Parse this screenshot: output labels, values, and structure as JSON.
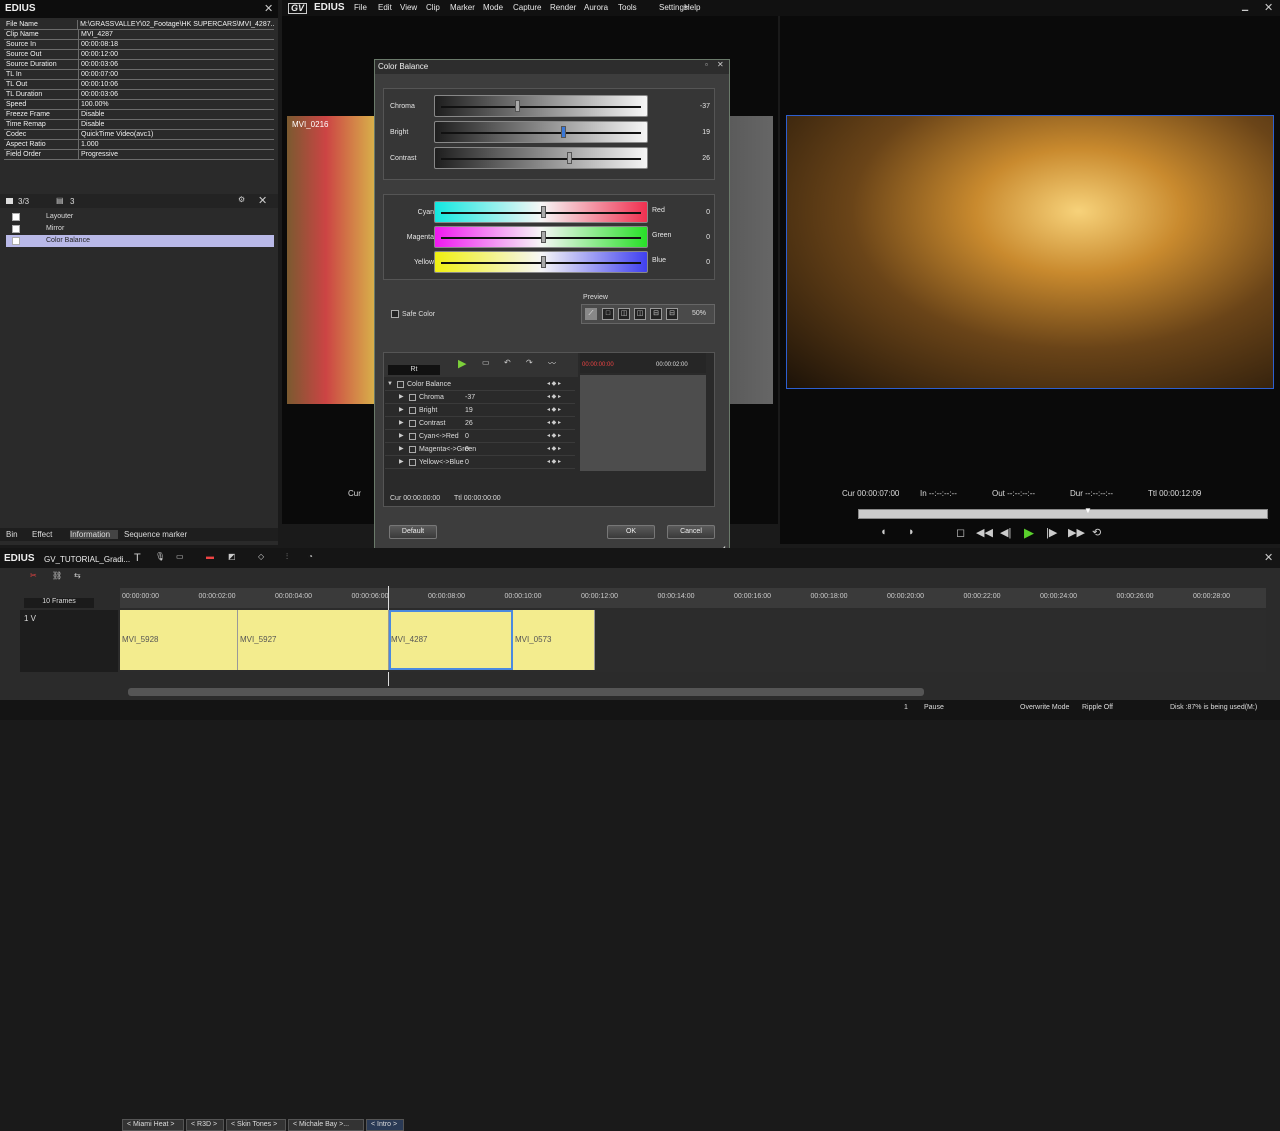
{
  "app": {
    "name": "EDIUS",
    "menus": [
      "File",
      "Edit",
      "View",
      "Clip",
      "Marker",
      "Mode",
      "Capture",
      "Render",
      "Aurora",
      "Tools",
      "Settings",
      "Help"
    ],
    "logo": "GV"
  },
  "info_panel": {
    "title": "EDIUS",
    "rows": [
      {
        "k": "File Name",
        "v": "M:\\GRASSVALLEY\\02_Footage\\HK SUPERCARS\\MVI_4287..."
      },
      {
        "k": "Clip Name",
        "v": "MVI_4287"
      },
      {
        "k": "Source In",
        "v": "00:00:08:18"
      },
      {
        "k": "Source Out",
        "v": "00:00:12:00"
      },
      {
        "k": "Source Duration",
        "v": "00:00:03:06"
      },
      {
        "k": "TL In",
        "v": "00:00:07:00"
      },
      {
        "k": "TL Out",
        "v": "00:00:10:06"
      },
      {
        "k": "TL Duration",
        "v": "00:00:03:06"
      },
      {
        "k": "Speed",
        "v": "100.00%"
      },
      {
        "k": "Freeze Frame",
        "v": "Disable"
      },
      {
        "k": "Time Remap",
        "v": "Disable"
      },
      {
        "k": "Codec",
        "v": "QuickTime Video(avc1)"
      },
      {
        "k": "Aspect Ratio",
        "v": "1.000"
      },
      {
        "k": "Field Order",
        "v": "Progressive"
      }
    ],
    "count_a": "3/3",
    "count_b": "3",
    "effects": [
      "Layouter",
      "Mirror",
      "Color Balance"
    ],
    "tabs": [
      "Bin",
      "Effect",
      "Information",
      "Sequence marker"
    ]
  },
  "player": {
    "clip_label": "MVI_0216",
    "cur_label": "Cur"
  },
  "recorder": {
    "cur": "Cur 00:00:07:00",
    "in": "In --:--:--:--",
    "out": "Out --:--:--:--",
    "dur": "Dur --:--:--:--",
    "ttl": "Ttl 00:00:12:09"
  },
  "dialog": {
    "title": "Color Balance",
    "sliders": [
      {
        "label": "Chroma",
        "value": "-37",
        "pos": 0.37
      },
      {
        "label": "Bright",
        "value": "19",
        "pos": 0.6
      },
      {
        "label": "Contrast",
        "value": "26",
        "pos": 0.63
      }
    ],
    "color_sliders": [
      {
        "left": "Cyan",
        "right": "Red",
        "value": "0",
        "pos": 0.5
      },
      {
        "left": "Magenta",
        "right": "Green",
        "value": "0",
        "pos": 0.5
      },
      {
        "left": "Yellow",
        "right": "Blue",
        "value": "0",
        "pos": 0.5
      }
    ],
    "safe_color": "Safe Color",
    "preview_label": "Preview",
    "preview_zoom": "50%",
    "kf_rows": [
      {
        "name": "Color Balance",
        "val": ""
      },
      {
        "name": "Chroma",
        "val": "-37"
      },
      {
        "name": "Bright",
        "val": "19"
      },
      {
        "name": "Contrast",
        "val": "26"
      },
      {
        "name": "Cyan<->Red",
        "val": "0"
      },
      {
        "name": "Magenta<->Green",
        "val": "0"
      },
      {
        "name": "Yellow<->Blue",
        "val": "0"
      }
    ],
    "kf_select": "Rt",
    "kf_t0": "00:00:00:00",
    "kf_t1": "00:00:02:00",
    "cur": "Cur 00:00:00:00",
    "ttl": "Ttl 00:00:00:00",
    "default": "Default",
    "ok": "OK",
    "cancel": "Cancel"
  },
  "timeline": {
    "title": "EDIUS",
    "project": "GV_TUTORIAL_Gradi...",
    "crumbs": [
      "< Miami Heat >",
      "< R3D >",
      "< Skin Tones >",
      "< Michale Bay >...",
      "< Intro >"
    ],
    "zoom": "10 Frames",
    "ticks": [
      "00:00:00:00",
      "00:00:02:00",
      "00:00:04:00",
      "00:00:06:00",
      "00:00:08:00",
      "00:00:10:00",
      "00:00:12:00",
      "00:00:14:00",
      "00:00:16:00",
      "00:00:18:00",
      "00:00:20:00",
      "00:00:22:00",
      "00:00:24:00",
      "00:00:26:00",
      "00:00:28:00"
    ],
    "track": "1 V",
    "clips": [
      "MVI_5928",
      "MVI_5927",
      "MVI_4287",
      "MVI_0573"
    ]
  },
  "status": {
    "num": "1",
    "pause": "Pause",
    "mode": "Overwrite Mode",
    "ripple": "Ripple Off",
    "disk": "Disk :87% is being used(M:)"
  }
}
